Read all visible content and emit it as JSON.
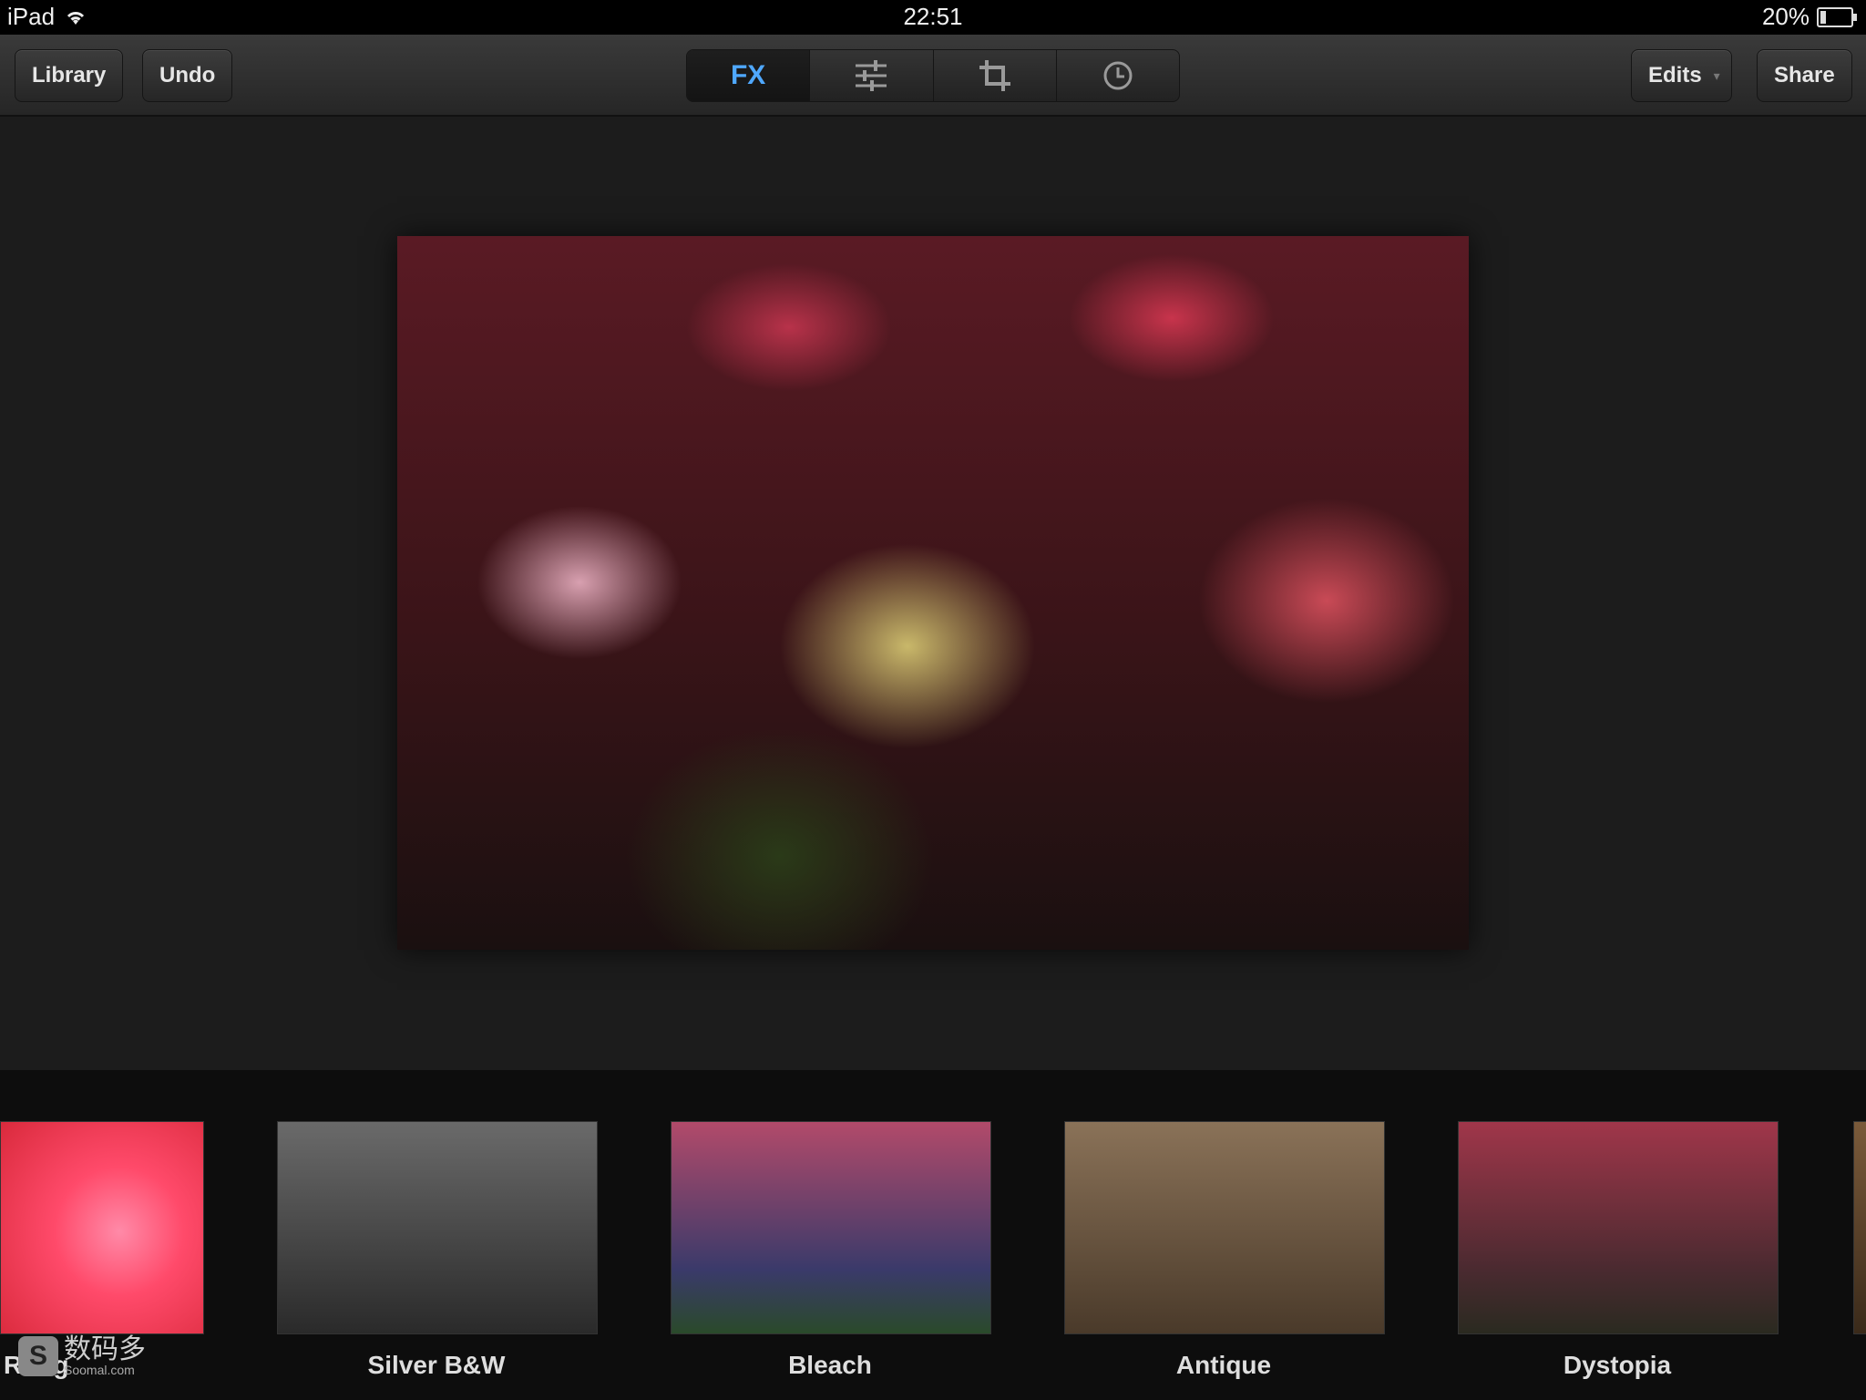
{
  "status_bar": {
    "device": "iPad",
    "time": "22:51",
    "battery": "20%",
    "battery_level": 0.2
  },
  "toolbar": {
    "library_label": "Library",
    "undo_label": "Undo",
    "fx_label": "FX",
    "edits_label": "Edits",
    "share_label": "Share"
  },
  "filters": [
    {
      "name": "Roug"
    },
    {
      "name": "Silver B&W"
    },
    {
      "name": "Bleach"
    },
    {
      "name": "Antique"
    },
    {
      "name": "Dystopia"
    }
  ],
  "watermark": {
    "logo": "S",
    "text": "数码多",
    "url": "Soomal.com"
  }
}
